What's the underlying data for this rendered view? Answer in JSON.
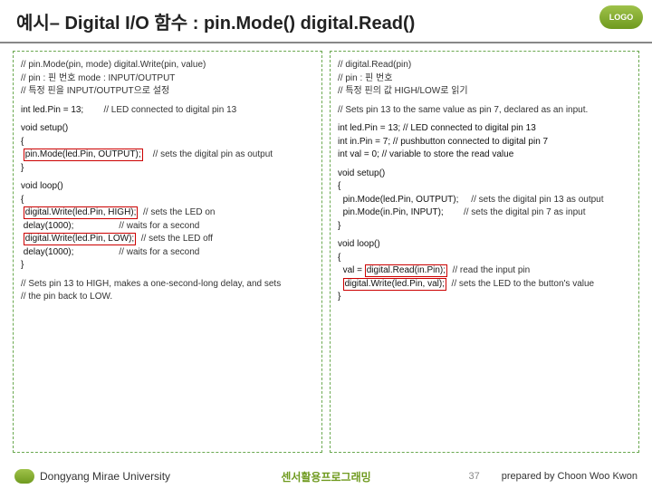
{
  "title": "예시– Digital I/O 함수 : pin.Mode() digital.Read()",
  "logo_text": "LOGO",
  "left": {
    "sig1": "// pin.Mode(pin, mode) digital.Write(pin, value)",
    "sig2": "// pin : 핀 번호 mode : INPUT/OUTPUT",
    "sig3": "// 특정 핀을 INPUT/OUTPUT으로 설정",
    "decl": "int led.Pin = 13;",
    "decl_c": "// LED connected to digital pin 13",
    "setup_open": "void setup()",
    "brace_o": "{",
    "pinmode": "pin.Mode(led.Pin, OUTPUT);",
    "pinmode_c": "// sets the digital pin as output",
    "brace_c": "}",
    "loop_open": "void loop()",
    "dw_high": "digital.Write(led.Pin, HIGH);",
    "dw_high_c": "// sets the LED on",
    "delay1": "delay(1000);",
    "delay1_c": "// waits for a second",
    "dw_low": "digital.Write(led.Pin, LOW);",
    "dw_low_c": "// sets the LED off",
    "delay2": "delay(1000);",
    "delay2_c": "// waits for a second",
    "note1": "// Sets pin 13 to HIGH, makes a one-second-long delay, and sets",
    "note2": "// the pin back to LOW."
  },
  "right": {
    "sig1": "// digital.Read(pin)",
    "sig2": "// pin : 핀 번호",
    "sig3": "// 특정 핀의 값 HIGH/LOW로 읽기",
    "note_top": "// Sets pin 13 to the same value as pin 7, declared as an input.",
    "led": "int led.Pin = 13; // LED connected to digital pin 13",
    "inpin": "int in.Pin = 7;   // pushbutton connected to digital pin 7",
    "val": "int val = 0;    // variable to store the read value",
    "setup_open": "void setup()",
    "brace_o": "{",
    "pm_out": "pin.Mode(led.Pin, OUTPUT);",
    "pm_out_c": "// sets the digital pin 13 as output",
    "pm_in": "pin.Mode(in.Pin, INPUT);",
    "pm_in_c": "// sets the digital pin 7 as input",
    "brace_c": "}",
    "loop_open": "void loop()",
    "read": "val = ",
    "read_hl": "digital.Read(in.Pin);",
    "read_c": "// read the input pin",
    "write_hl": "digital.Write(led.Pin, val);",
    "write_c": "// sets the LED to the button's value"
  },
  "footer": {
    "university": "Dongyang Mirae University",
    "center": "센서활용프로그래밍",
    "page": "37",
    "prepared": "prepared by Choon Woo Kwon"
  }
}
